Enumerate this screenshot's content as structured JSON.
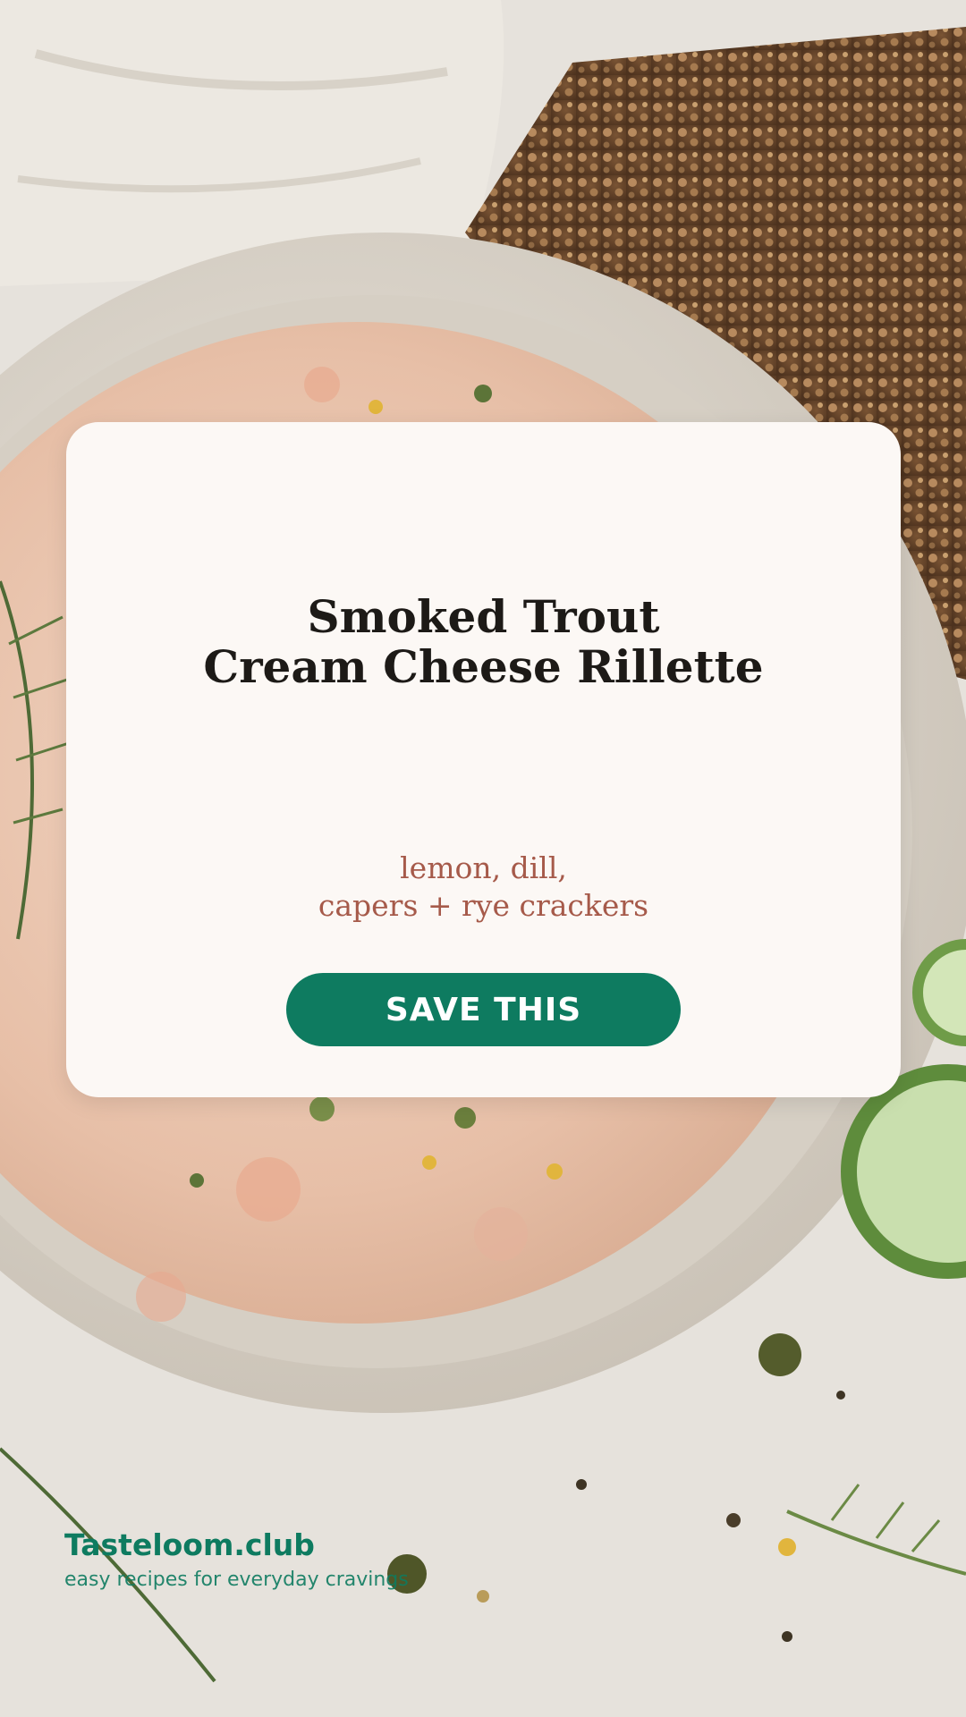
{
  "card": {
    "title_line1": "Smoked Trout",
    "title_line2": "Cream Cheese Rillette",
    "subtitle_line1": "lemon, dill,",
    "subtitle_line2": "capers + rye crackers",
    "save_label": "SAVE THIS"
  },
  "brand": {
    "name": "Tasteloom.club",
    "tagline": "easy recipes for everyday cravings"
  },
  "colors": {
    "accent": "#0e7b60",
    "card_bg": "#fcf8f5",
    "subtitle": "#a65a4a",
    "title": "#1d1a17"
  }
}
